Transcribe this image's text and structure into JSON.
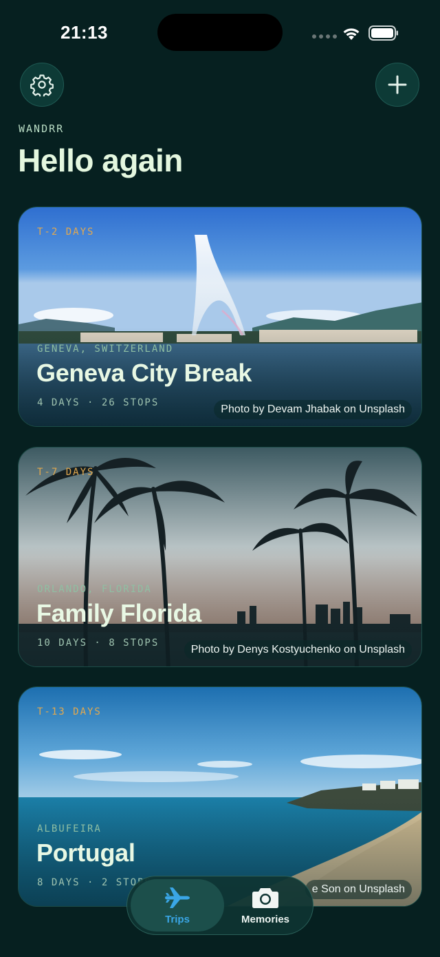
{
  "status_bar": {
    "time": "21:13"
  },
  "header": {
    "app_name": "WANDRR",
    "greeting": "Hello again"
  },
  "trips": [
    {
      "countdown": "T-2 DAYS",
      "location": "GENEVA, SWITZERLAND",
      "title": "Geneva City Break",
      "meta": "4 DAYS · 26 STOPS",
      "photo_credit": "Photo by Devam Jhabak on Unsplash"
    },
    {
      "countdown": "T-7 DAYS",
      "location": "ORLANDO, FLORIDA",
      "title": "Family Florida",
      "meta": "10 DAYS · 8 STOPS",
      "photo_credit": "Photo by Denys Kostyuchenko on Unsplash"
    },
    {
      "countdown": "T-13 DAYS",
      "location": "ALBUFEIRA",
      "title": "Portugal",
      "meta": "8 DAYS · 2 STOPS",
      "photo_credit": "e Son on Unsplash"
    }
  ],
  "tabs": {
    "trips": {
      "label": "Trips",
      "icon": "airplane-icon",
      "active": true
    },
    "memories": {
      "label": "Memories",
      "icon": "camera-icon",
      "active": false
    }
  },
  "colors": {
    "background": "#062020",
    "accent_countdown": "#e3a94e",
    "active_tab": "#3aa6e6",
    "title_text": "#e8f8e4"
  }
}
